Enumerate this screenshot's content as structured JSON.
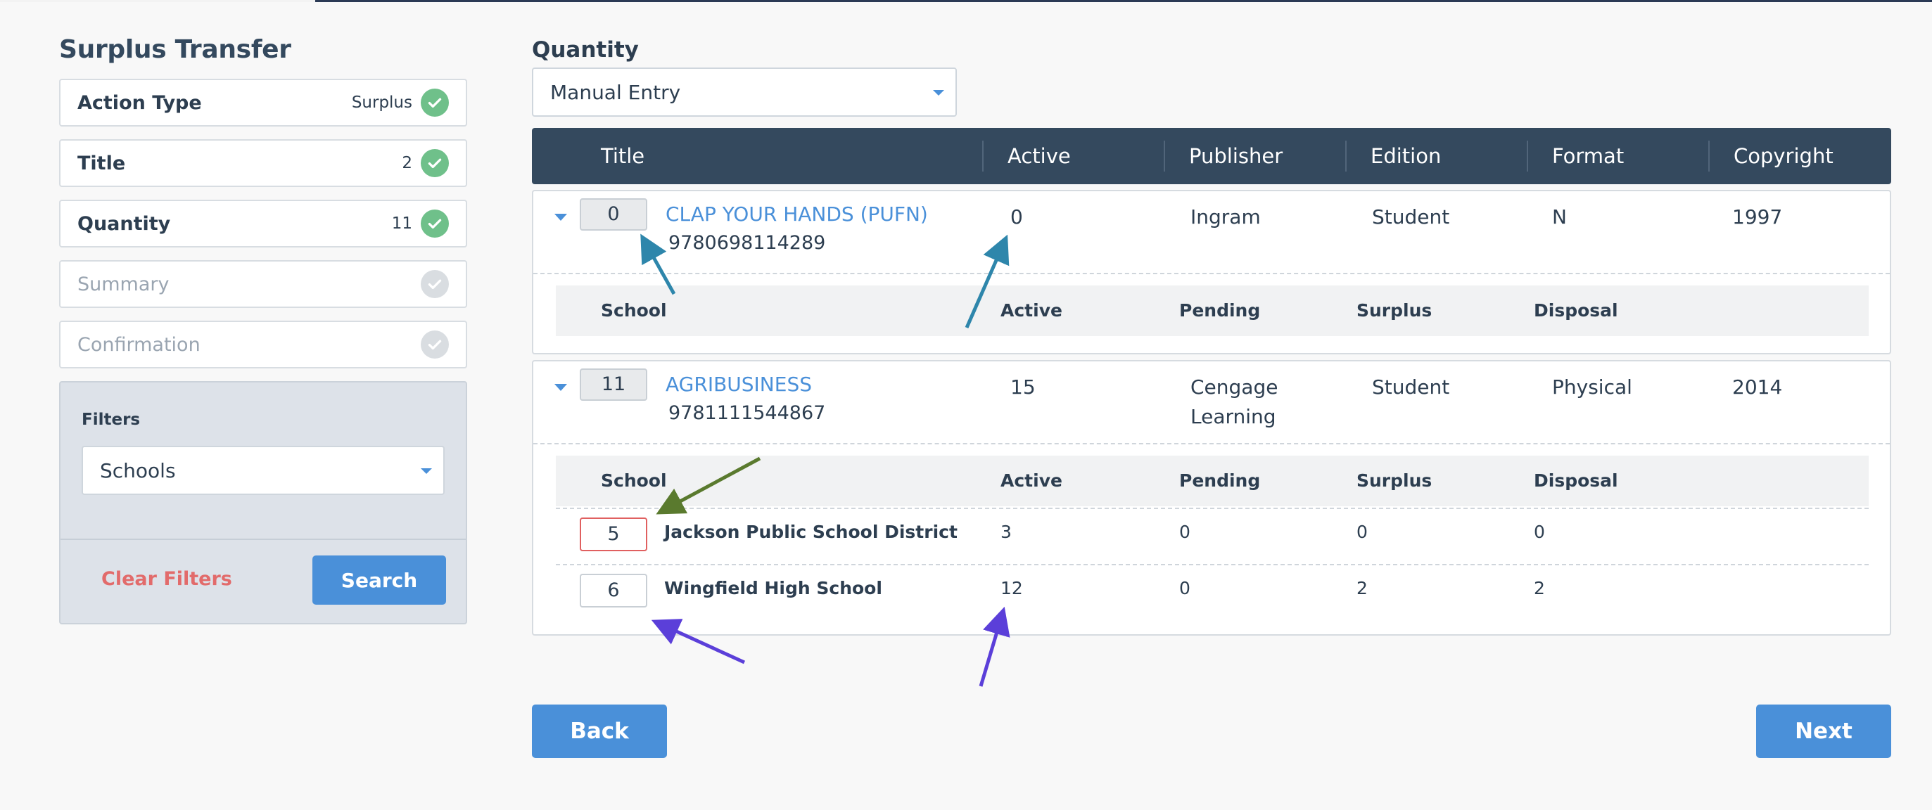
{
  "sidebar": {
    "title": "Surplus Transfer",
    "steps": [
      {
        "label": "Action Type",
        "value": "Surplus",
        "done": true
      },
      {
        "label": "Title",
        "value": "2",
        "done": true
      },
      {
        "label": "Quantity",
        "value": "11",
        "done": true
      },
      {
        "label": "Summary",
        "value": "",
        "done": false
      },
      {
        "label": "Confirmation",
        "value": "",
        "done": false
      }
    ],
    "filters": {
      "label": "Filters",
      "selected": "Schools",
      "clear_label": "Clear Filters",
      "search_label": "Search"
    }
  },
  "main": {
    "quantity_label": "Quantity",
    "quantity_mode": "Manual Entry",
    "columns": [
      "Title",
      "Active",
      "Publisher",
      "Edition",
      "Format",
      "Copyright"
    ],
    "sub_columns": [
      "School",
      "Active",
      "Pending",
      "Surplus",
      "Disposal"
    ],
    "titles": [
      {
        "qty": "0",
        "title": "CLAP YOUR HANDS (PUFN)",
        "isbn": "9780698114289",
        "active": "0",
        "publisher": "Ingram",
        "edition": "Student",
        "format": "N",
        "copyright": "1997",
        "schools": []
      },
      {
        "qty": "11",
        "title": "AGRIBUSINESS",
        "isbn": "9781111544867",
        "active": "15",
        "publisher_line1": "Cengage",
        "publisher_line2": "Learning",
        "edition": "Student",
        "format": "Physical",
        "copyright": "2014",
        "schools": [
          {
            "qty": "5",
            "name": "Jackson Public School District",
            "active": "3",
            "pending": "0",
            "surplus": "0",
            "disposal": "0"
          },
          {
            "qty": "6",
            "name": "Wingfield High School",
            "active": "12",
            "pending": "0",
            "surplus": "2",
            "disposal": "2"
          }
        ]
      }
    ],
    "back_label": "Back",
    "next_label": "Next"
  },
  "colors": {
    "header": "#34495e",
    "accent": "#4a90d9",
    "check": "#6fc08a",
    "danger": "#e26b6b",
    "arrow_teal": "#2e86ab",
    "arrow_green": "#5a7a2e",
    "arrow_purple": "#5b3fd9"
  }
}
